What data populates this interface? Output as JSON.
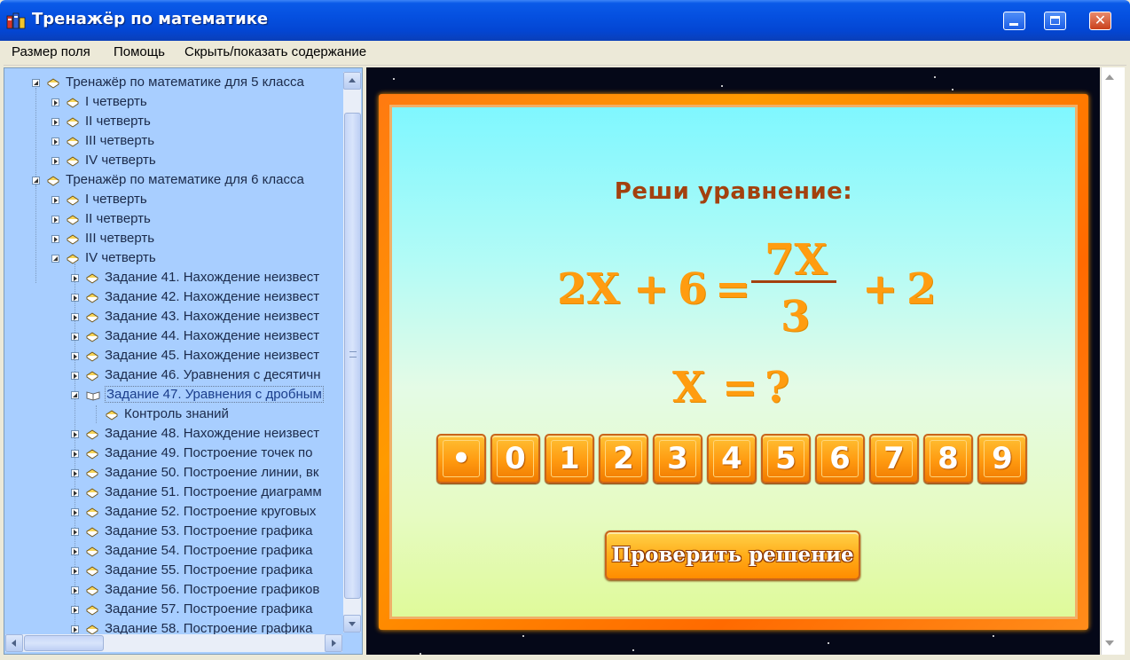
{
  "window": {
    "title": "Тренажёр по математике"
  },
  "menu": {
    "items": [
      {
        "label": "Размер поля"
      },
      {
        "label": "Помощь"
      },
      {
        "label": "Скрыть/показать содержание"
      }
    ]
  },
  "tree": {
    "items": [
      {
        "label": "Тренажёр по математике для 5 класса"
      },
      {
        "label": "I четверть"
      },
      {
        "label": "II четверть"
      },
      {
        "label": "III четверть"
      },
      {
        "label": "IV четверть"
      },
      {
        "label": "Тренажёр по математике для 6 класса"
      },
      {
        "label": "I четверть"
      },
      {
        "label": "II четверть"
      },
      {
        "label": "III четверть"
      },
      {
        "label": "IV четверть"
      },
      {
        "label": "Задание 41. Нахождение неизвест"
      },
      {
        "label": "Задание 42. Нахождение неизвест"
      },
      {
        "label": "Задание 43. Нахождение неизвест"
      },
      {
        "label": "Задание 44. Нахождение неизвест"
      },
      {
        "label": "Задание 45. Нахождение неизвест"
      },
      {
        "label": "Задание 46. Уравнения с десятичн"
      },
      {
        "label": "Задание 47. Уравнения с дробным"
      },
      {
        "label": "Контроль знаний"
      },
      {
        "label": "Задание 48. Нахождение неизвест"
      },
      {
        "label": "Задание 49. Построение точек по"
      },
      {
        "label": "Задание 50. Построение линии, вк"
      },
      {
        "label": "Задание 51. Построение диаграмм"
      },
      {
        "label": "Задание 52. Построение круговых"
      },
      {
        "label": "Задание 53. Построение графика"
      },
      {
        "label": "Задание 54. Построение графика"
      },
      {
        "label": "Задание 55. Построение графика"
      },
      {
        "label": "Задание 56. Построение графиков"
      },
      {
        "label": "Задание 57. Построение графика"
      },
      {
        "label": "Задание 58. Построение графика"
      }
    ],
    "selected_item": "Задание 47. Уравнения с дробным"
  },
  "exercise": {
    "heading": "Реши уравнение:",
    "lhs_term": "2X",
    "plus1": "+",
    "lhs_const": "6",
    "equals": "=",
    "numerator": "7X",
    "denominator": "3",
    "plus2": "+",
    "rhs_const": "2",
    "answer_var": "X",
    "answer_equals": "=",
    "answer_unknown": "?",
    "keypad": [
      "•",
      "0",
      "1",
      "2",
      "3",
      "4",
      "5",
      "6",
      "7",
      "8",
      "9"
    ],
    "check_label": "Проверить решение"
  },
  "colors": {
    "title_bar": "#0550e0",
    "tree_bg": "#a8ceff",
    "heading": "#a3410e",
    "equation": "#ff9c10",
    "button_orange": "#ff9a10",
    "frame_orange": "#ff7a10"
  },
  "icons": {
    "app": "app-icon",
    "tree_item": "book-icon",
    "tree_selected": "open-book-icon"
  }
}
